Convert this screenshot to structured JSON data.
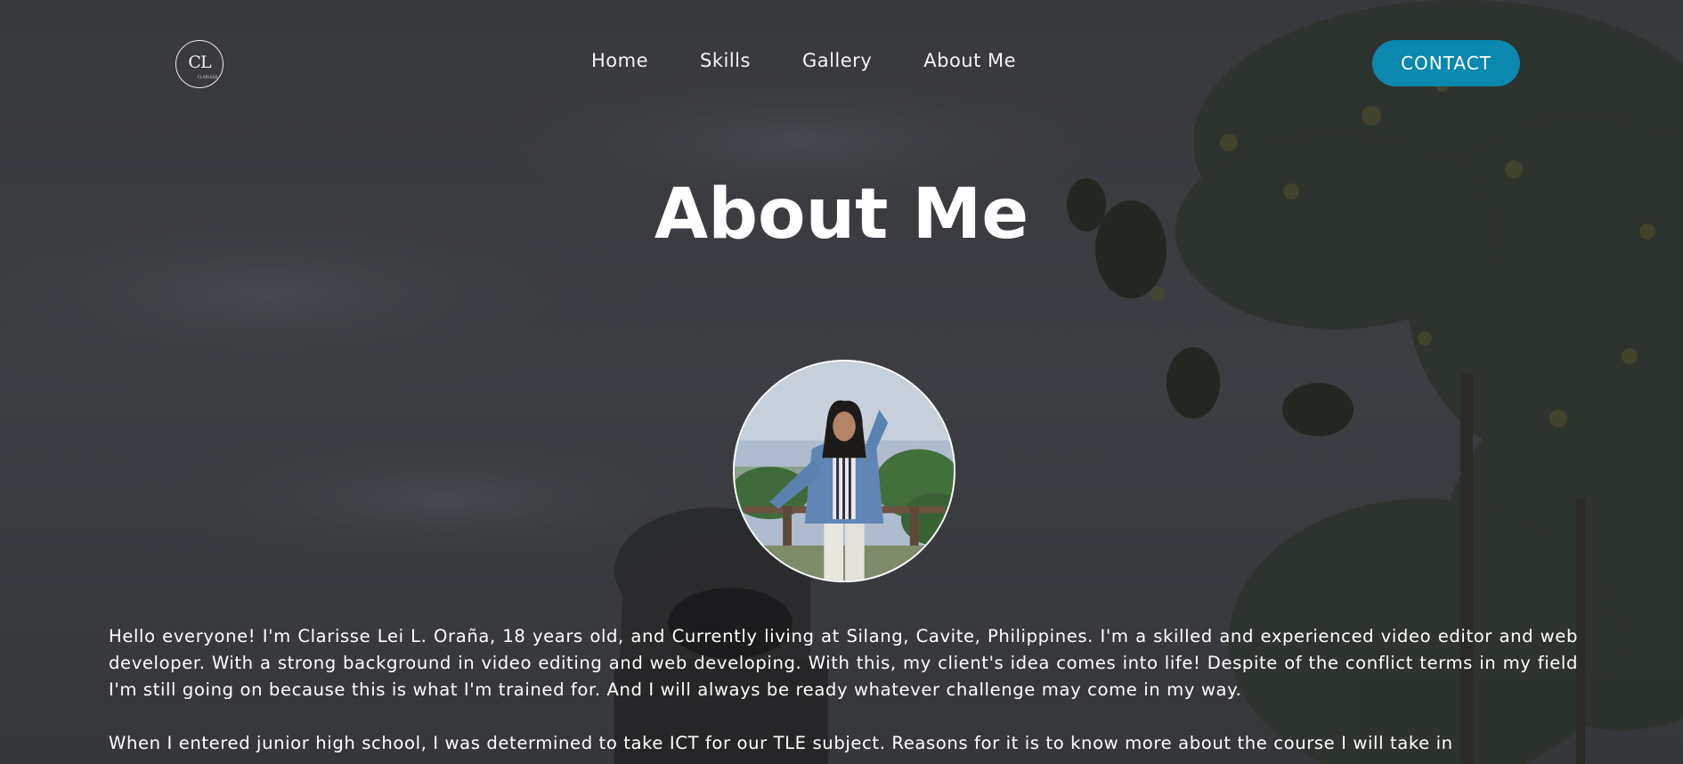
{
  "nav": {
    "logo_text": "CL",
    "logo_sub": "CLARISSE",
    "links": [
      "Home",
      "Skills",
      "Gallery",
      "About Me"
    ],
    "contact_label": "CONTACT"
  },
  "main": {
    "title": "About Me",
    "paragraphs": [
      "Hello everyone! I'm Clarisse Lei L. Oraña, 18 years old, and Currently living at Silang, Cavite, Philippines. I'm a skilled and experienced video editor and web developer. With a strong background in video editing and web developing. With this, my client's idea comes into life! Despite of the conflict terms in my field I'm still going on because this is what I'm trained for. And I will always be ready whatever challenge may come in my way.",
      "When I entered junior high school, I was determined to take ICT for our TLE subject. Reasons for it is to know more about the course I will take in"
    ]
  },
  "colors": {
    "accent": "#0a88ad",
    "background": "#3a3b3f",
    "text": "#ffffff"
  },
  "icons": {
    "logo": "cl-monogram-logo",
    "profile": "profile-photo"
  }
}
